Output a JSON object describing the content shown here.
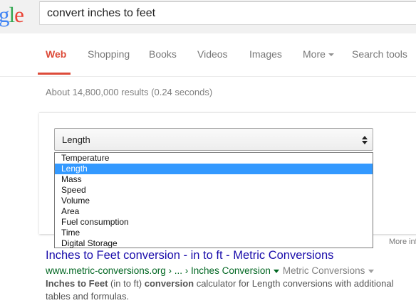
{
  "logo": {
    "text_g": "g",
    "text_l": "l",
    "text_e": "e"
  },
  "search": {
    "value": "convert inches to feet"
  },
  "tabs": [
    {
      "label": "Web",
      "active": true
    },
    {
      "label": "Shopping"
    },
    {
      "label": "Books"
    },
    {
      "label": "Videos"
    },
    {
      "label": "Images"
    },
    {
      "label": "More"
    },
    {
      "label": "Search tools"
    }
  ],
  "stats": "About 14,800,000 results (0.24 seconds)",
  "converter": {
    "selected": "Length",
    "options": [
      "Temperature",
      "Length",
      "Mass",
      "Speed",
      "Volume",
      "Area",
      "Fuel consumption",
      "Time",
      "Digital Storage"
    ],
    "more_info": "More info"
  },
  "result": {
    "title": "Inches to Feet conversion - in to ft - Metric Conversions",
    "url": "www.metric-conversions.org › ... › Inches Conversion",
    "url_extra": "Metric Conversions",
    "snippet_b1": "Inches to Feet",
    "snippet_t1": " (in to ft) ",
    "snippet_b2": "conversion",
    "snippet_t2": " calculator for Length conversions with additional tables and formulas."
  },
  "colors": {
    "accent": "#dd4b39",
    "link": "#1a0dab",
    "url": "#006621",
    "highlight": "#3399ff"
  }
}
